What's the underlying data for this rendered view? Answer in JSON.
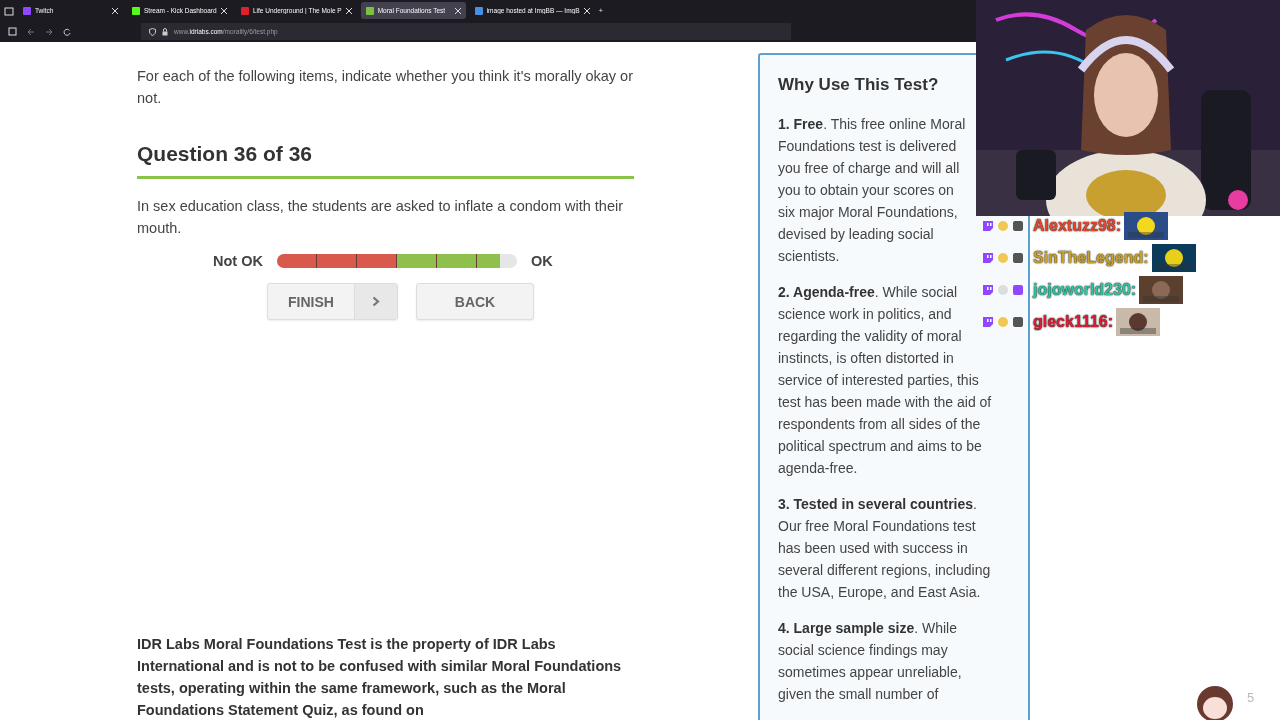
{
  "browser": {
    "tabs": [
      {
        "title": "Twitch",
        "selected": false,
        "color": "#9146ff"
      },
      {
        "title": "Stream - Kick Dashboard",
        "selected": false,
        "color": "#53fc18"
      },
      {
        "title": "Life Underground | The Mole P",
        "selected": false,
        "color": "#e0202a"
      },
      {
        "title": "Moral Foundations Test",
        "selected": true,
        "color": "#7cc242"
      },
      {
        "title": "image hosted at ImgBB — ImgB",
        "selected": false,
        "color": "#4a90e2"
      }
    ],
    "new_tab": "+",
    "address": "www.**idrlabs.com**/morality/6/test.php"
  },
  "intro": "For each of the following items, indicate whether you think it's morally okay or not.",
  "question": {
    "heading": "Question 36 of 36",
    "text": "In sex education class, the students are asked to inflate a condom with their mouth.",
    "scale": {
      "low_label": "Not OK",
      "high_label": "OK",
      "level": 0.93
    },
    "buttons": [
      {
        "label": "FINISH",
        "kind": "next"
      },
      {
        "label": "BACK",
        "kind": "plain"
      }
    ]
  },
  "footer": "IDR Labs Moral Foundations Test is the property of IDR Labs International and is not to be confused with similar Moral Foundations tests, operating within the same framework, such as the Moral Foundations Statement Quiz, as found on",
  "sidebar": {
    "title": "Why Use This Test?",
    "paragraphs": [
      {
        "lines": [
          "**1. Free**. This free online Moral",
          "Foundations test is delivered",
          "you free of charge and will all",
          "you to obtain your scores on",
          "six major Moral Foundations,",
          "devised by leading social",
          "scientists."
        ]
      },
      {
        "lines": [
          "**2. Agenda-free**. While social",
          "science work in politics, and",
          "regarding the validity of moral",
          "instincts, is often distorted in",
          "service of interested parties, this",
          "test has been made with the aid of",
          "respondents from all sides of the",
          "political spectrum and aims to be",
          "agenda-free."
        ]
      },
      {
        "lines": [
          "**3. Tested in several countries**.",
          "Our free Moral Foundations test",
          "has been used with success in",
          "several different regions, including",
          "the USA, Europe, and East Asia."
        ]
      },
      {
        "lines": [
          "**4. Large sample size**. While",
          "social science findings may",
          "sometimes appear unreliable,",
          "given the small number of"
        ]
      }
    ]
  },
  "chat": [
    {
      "name": "Alextuzz98:",
      "color": "#e8452a"
    },
    {
      "name": "SinTheLegend:",
      "color": "#c9a227"
    },
    {
      "name": "jojoworld230:",
      "color": "#2ec4a0"
    },
    {
      "name": "gleck1116:",
      "color": "#d81e34"
    }
  ],
  "overlay_count": "5"
}
